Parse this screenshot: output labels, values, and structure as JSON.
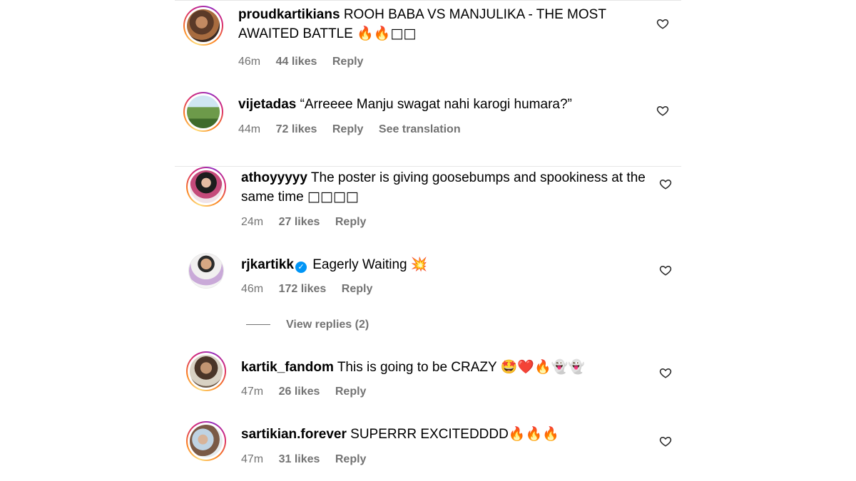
{
  "comments": [
    {
      "username": "proudkartikians",
      "text": "ROOH BABA VS MANJULIKA - THE MOST AWAITED BATTLE",
      "emoji": "🔥🔥□□",
      "time": "46m",
      "likes": "44 likes",
      "reply": "Reply",
      "extra": ""
    },
    {
      "username": "vijetadas",
      "text": "“Arreeee Manju swagat nahi karogi humara?”",
      "emoji": "",
      "time": "44m",
      "likes": "72 likes",
      "reply": "Reply",
      "extra": "See translation"
    },
    {
      "username": "athoyyyyy",
      "text": "The poster is giving goosebumps and spookiness at the same time",
      "emoji": "□□□□",
      "time": "24m",
      "likes": "27 likes",
      "reply": "Reply",
      "extra": ""
    },
    {
      "username": "rjkartikk",
      "text": "Eagerly Waiting",
      "emoji": "💥",
      "time": "46m",
      "likes": "172 likes",
      "reply": "Reply",
      "extra": "",
      "verified": "✓"
    },
    {
      "username": "kartik_fandom",
      "text": "This is going to be CRAZY",
      "emoji": "🤩❤️🔥👻👻",
      "time": "47m",
      "likes": "26 likes",
      "reply": "Reply",
      "extra": ""
    },
    {
      "username": "sartikian.forever",
      "text": "SUPERRR EXCITEDDDD",
      "emoji": "🔥🔥🔥",
      "time": "47m",
      "likes": "31 likes",
      "reply": "Reply",
      "extra": ""
    }
  ],
  "view_replies": "View replies (2)",
  "icons": {
    "like": "heart-outline-icon",
    "verified": "verified-badge-icon"
  },
  "colors": {
    "meta_text": "#737373",
    "verified_blue": "#0095f6",
    "story_ring": "#d62976"
  }
}
